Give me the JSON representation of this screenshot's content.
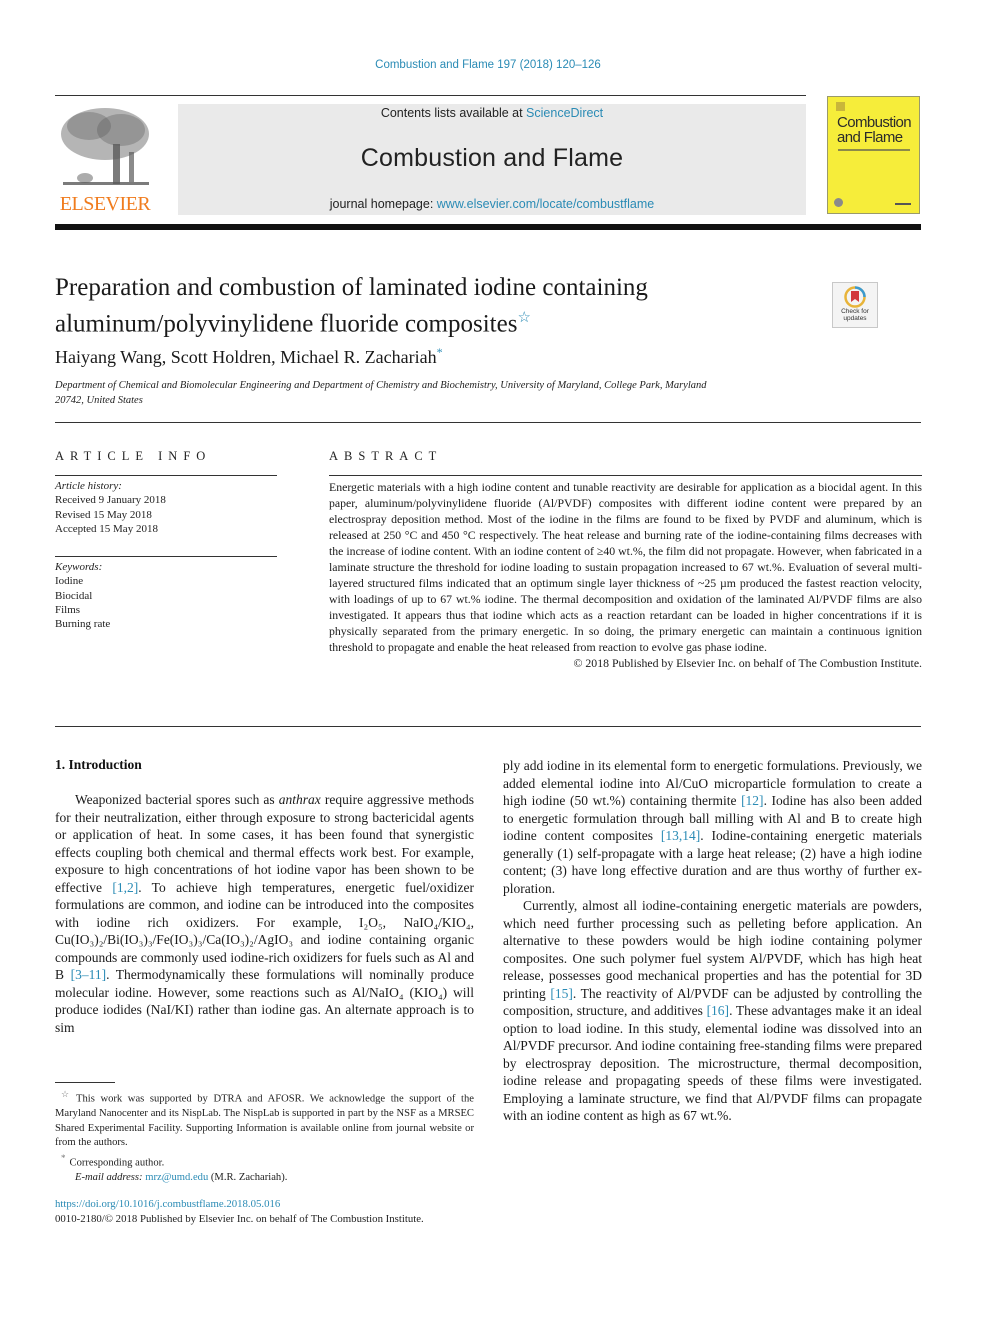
{
  "running_head": "Combustion and Flame 197 (2018) 120–126",
  "masthead": {
    "publisher": "ELSEVIER",
    "contents_prefix": "Contents lists available at ",
    "contents_link": "ScienceDirect",
    "journal_name": "Combustion and Flame",
    "homepage_prefix": "journal homepage: ",
    "homepage_link": "www.elsevier.com/locate/combustflame",
    "cover_title_line1": "Combustion",
    "cover_title_line2": "and Flame"
  },
  "article": {
    "title_line1": "Preparation and combustion of laminated iodine containing",
    "title_line2": "aluminum/polyvinylidene fluoride composites",
    "title_note_mark": "☆",
    "check_updates_line1": "Check for",
    "check_updates_line2": "updates",
    "authors": "Haiyang Wang, Scott Holdren, Michael R. Zachariah",
    "corresponding_mark": "*",
    "affiliation_line1": "Department of Chemical and Biomolecular Engineering and Department of Chemistry and Biochemistry, University of Maryland, College Park, Maryland",
    "affiliation_line2": "20742, United States"
  },
  "article_info": {
    "heading": "ARTICLE INFO",
    "history_label": "Article history:",
    "history": [
      "Received 9 January 2018",
      "Revised 15 May 2018",
      "Accepted 15 May 2018"
    ],
    "keywords_label": "Keywords:",
    "keywords": [
      "Iodine",
      "Biocidal",
      "Films",
      "Burning rate"
    ]
  },
  "abstract": {
    "heading": "ABSTRACT",
    "text": "Energetic materials with a high iodine content and tunable reactivity are desirable for application as a biocidal agent. In this paper, aluminum/polyvinylidene fluoride (Al/PVDF) composites with different io­dine content were prepared by an electrospray deposition method. Most of the iodine in the films are found to be fixed by PVDF and aluminum, which is released at 250 °C and 450 °C respectively. The heat release and burning rate of the iodine-containing films decreases with the increase of iodine content. With an iodine content of ≥40 wt.%, the film did not propagate. However, when fabricated in a laminate structure the threshold for iodine loading to sustain propagation increased to 67 wt.%. Evaluation of sev­eral multi-layered structured films indicated that an optimum single layer thickness of ~25 µm produced the fastest reaction velocity, with loadings of up to 67 wt.% iodine. The thermal decomposition and oxi­dation of the laminated Al/PVDF films are also investigated. It appears thus that iodine which acts as a reaction retardant can be loaded in higher concentrations if it is physically separated from the primary energetic. In so doing, the primary energetic can maintain a continuous ignition threshold to propagate and enable the heat released from reaction to evolve gas phase iodine.",
    "copyright": "© 2018 Published by Elsevier Inc. on behalf of The Combustion Institute."
  },
  "body": {
    "section_heading": "1. Introduction",
    "left_p1_a": "Weaponized bacterial spores such as ",
    "left_p1_italic": "anthrax",
    "left_p1_b": " require aggres­sive methods for their neutralization, either through exposure to strong bactericidal agents or application of heat. In some cases, it has been found that synergistic effects coupling both chemi­cal and thermal effects work best. For example, exposure to high concentrations of hot iodine vapor has been shown to be effec­tive ",
    "ref_1_2": "[1,2]",
    "left_p1_c": ". To achieve high temperatures, energetic fuel/oxidizer formulations are common, and iodine can be introduced into the composites with iodine rich oxidizers. For example, ",
    "formula_i2o5": "I₂O₅",
    "formula_list": "NaIO₄/KIO₄, Cu(IO₃)₂/Bi(IO₃)₃/Fe(IO₃)₃/Ca(IO₃)₂/AgIO₃",
    "left_p1_d": " and iodine containing organic compounds are commonly used iodine-rich ox­idizers for fuels such as Al and B ",
    "ref_3_11": "[3–11]",
    "left_p1_e": ". Thermodynamically these formulations will nominally produce molecular iodine. How­ever, some reactions such as Al/NaIO₄ (KIO₄) will produce iodides (NaI/KI) rather than iodine gas. An alternate approach is to sim­",
    "right_p1_a": "ply add iodine in its elemental form to energetic formulations. Previously, we added elemental iodine into Al/CuO microparticle formulation to create a high iodine (50 wt.%) containing thermite ",
    "ref_12": "[12]",
    "right_p1_b": ". Iodine has also been added to energetic formulation through ball milling with Al and B to create high iodine content compos­ites ",
    "ref_13_14": "[13,14]",
    "right_p1_c": ". Iodine-containing energetic materials generally (1) self-propagate with a large heat release; (2) have a high iodine content; (3) have long effective duration and are thus worthy of further ex­ploration.",
    "right_p2_a": "Currently, almost all iodine-containing energetic materials are powders, which need further processing such as pelleting before application. An alternative to these powders would be high io­dine containing polymer composites. One such polymer fuel sys­tem Al/PVDF, which has high heat release, possesses good me­chanical properties and has the potential for 3D printing ",
    "ref_15": "[15]",
    "right_p2_b": ". The reactivity of Al/PVDF can be adjusted by controlling the com­position, structure, and additives ",
    "ref_16": "[16]",
    "right_p2_c": ". These advantages make it an ideal option to load iodine. In this study, elemental iodine was dissolved into an Al/PVDF precursor. And iodine containing free-standing films were prepared by electrospray deposition. The mi­crostructure, thermal decomposition, iodine release and propagat­ing speeds of these films were investigated. Employing a laminate structure, we find that Al/PVDF films can propagate with an iodine content as high as 67 wt.%."
  },
  "footnotes": {
    "funding_mark": "☆",
    "funding_text": "This work was supported by DTRA and AFOSR. We acknowledge the support of the Maryland Nanocenter and its NispLab. The NispLab is supported in part by the NSF as a MRSEC Shared Experimental Facility. Supporting Information is available online from journal website or from the authors.",
    "corr_mark": "*",
    "corr_text": "Corresponding author.",
    "email_label": "E-mail address: ",
    "email": "mrz@umd.edu",
    "email_suffix": " (M.R. Zachariah)."
  },
  "doi": {
    "link": "https://doi.org/10.1016/j.combustflame.2018.05.016",
    "issn_line": "0010-2180/© 2018 Published by Elsevier Inc. on behalf of The Combustion Institute."
  },
  "colors": {
    "link": "#2a8bb5",
    "elsevier_orange": "#f07c1e",
    "cover_yellow": "#f6ed3a",
    "band_gray": "#eaeaea"
  }
}
